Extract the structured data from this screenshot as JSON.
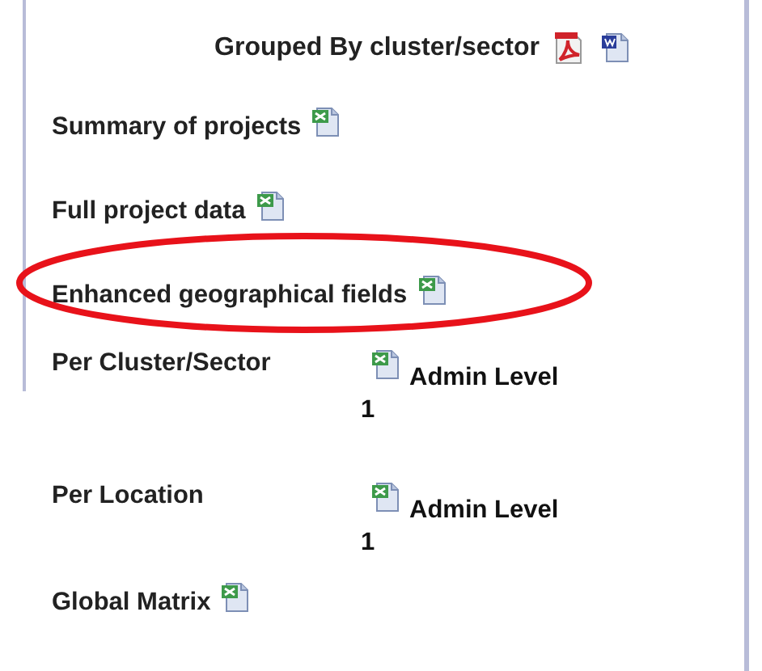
{
  "heading": {
    "label": "Grouped By cluster/sector",
    "icons": [
      {
        "kind": "pdf"
      },
      {
        "kind": "word"
      }
    ]
  },
  "reports": [
    {
      "kind": "simple",
      "label": "Summary of projects",
      "icons": [
        {
          "kind": "excel"
        }
      ],
      "highlighted": false
    },
    {
      "kind": "simple",
      "label": "Full project data",
      "icons": [
        {
          "kind": "excel"
        }
      ],
      "highlighted": false
    },
    {
      "kind": "simple",
      "label": "Enhanced geographical fields",
      "icons": [
        {
          "kind": "excel"
        }
      ],
      "highlighted": true
    },
    {
      "kind": "levels",
      "label": "Per Cluster/Sector",
      "icons": [
        {
          "kind": "excel"
        }
      ],
      "level_link": "Admin Level 1",
      "highlighted": false
    },
    {
      "kind": "levels",
      "label": "Per Location",
      "icons": [
        {
          "kind": "excel"
        }
      ],
      "level_link": "Admin Level 1",
      "highlighted": false
    },
    {
      "kind": "simple",
      "label": "Global Matrix",
      "icons": [
        {
          "kind": "excel"
        }
      ],
      "highlighted": false
    }
  ]
}
